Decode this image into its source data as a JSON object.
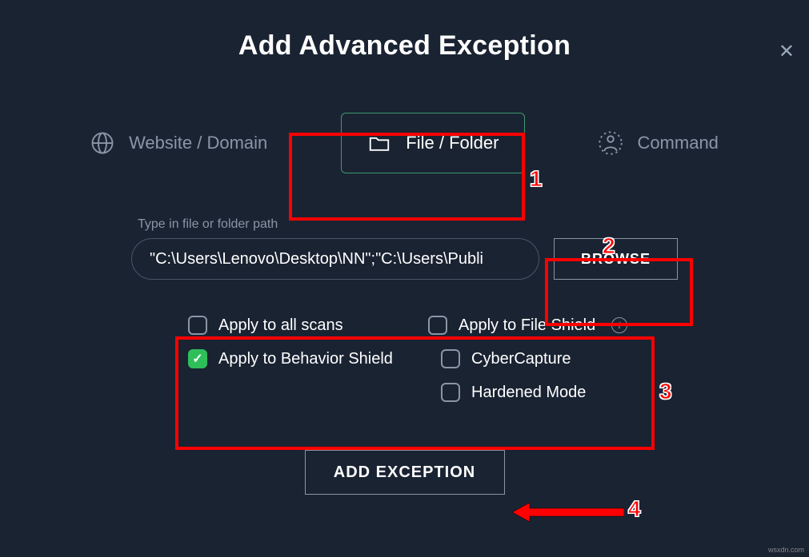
{
  "close_symbol": "✕",
  "title": "Add Advanced Exception",
  "tabs": {
    "website": {
      "label": "Website / Domain"
    },
    "file": {
      "label": "File / Folder"
    },
    "command": {
      "label": "Command"
    }
  },
  "path": {
    "label": "Type in file or folder path",
    "value": "\"C:\\Users\\Lenovo\\Desktop\\NN\";\"C:\\Users\\Publi"
  },
  "browse_label": "BROWSE",
  "options": {
    "all_scans": {
      "label": "Apply to all scans",
      "checked": false
    },
    "behavior_shield": {
      "label": "Apply to Behavior Shield",
      "checked": true
    },
    "file_shield": {
      "label": "Apply to File Shield",
      "checked": false,
      "info": true
    },
    "cybercapture": {
      "label": "CyberCapture",
      "checked": false
    },
    "hardened_mode": {
      "label": "Hardened Mode",
      "checked": false
    }
  },
  "add_label": "ADD EXCEPTION",
  "annotations": {
    "n1": "1",
    "n2": "2",
    "n3": "3",
    "n4": "4"
  },
  "watermark": "wsxdn.com"
}
